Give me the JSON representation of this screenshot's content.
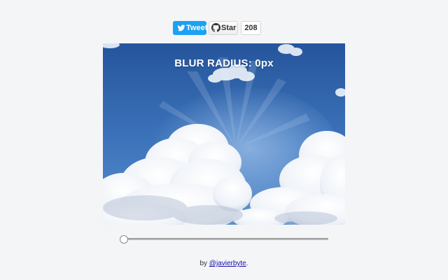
{
  "share": {
    "tweet_label": "Tweet",
    "star_label": "Star",
    "star_count": "208"
  },
  "image": {
    "overlay_text": "BLUR RADIUS: 0px"
  },
  "slider": {
    "value": 0,
    "min": 0,
    "max": 100
  },
  "credit": {
    "prefix": "by ",
    "handle": "@javierbyte",
    "suffix": "."
  },
  "colors": {
    "tweet_blue": "#1da1f2",
    "sky_top": "#2c5fa8",
    "sky_bottom": "#4f86c8",
    "link": "#1a0dab",
    "background": "#f4f5f7"
  },
  "icons": {
    "tweet": "twitter-bird-icon",
    "star": "github-octocat-icon"
  }
}
